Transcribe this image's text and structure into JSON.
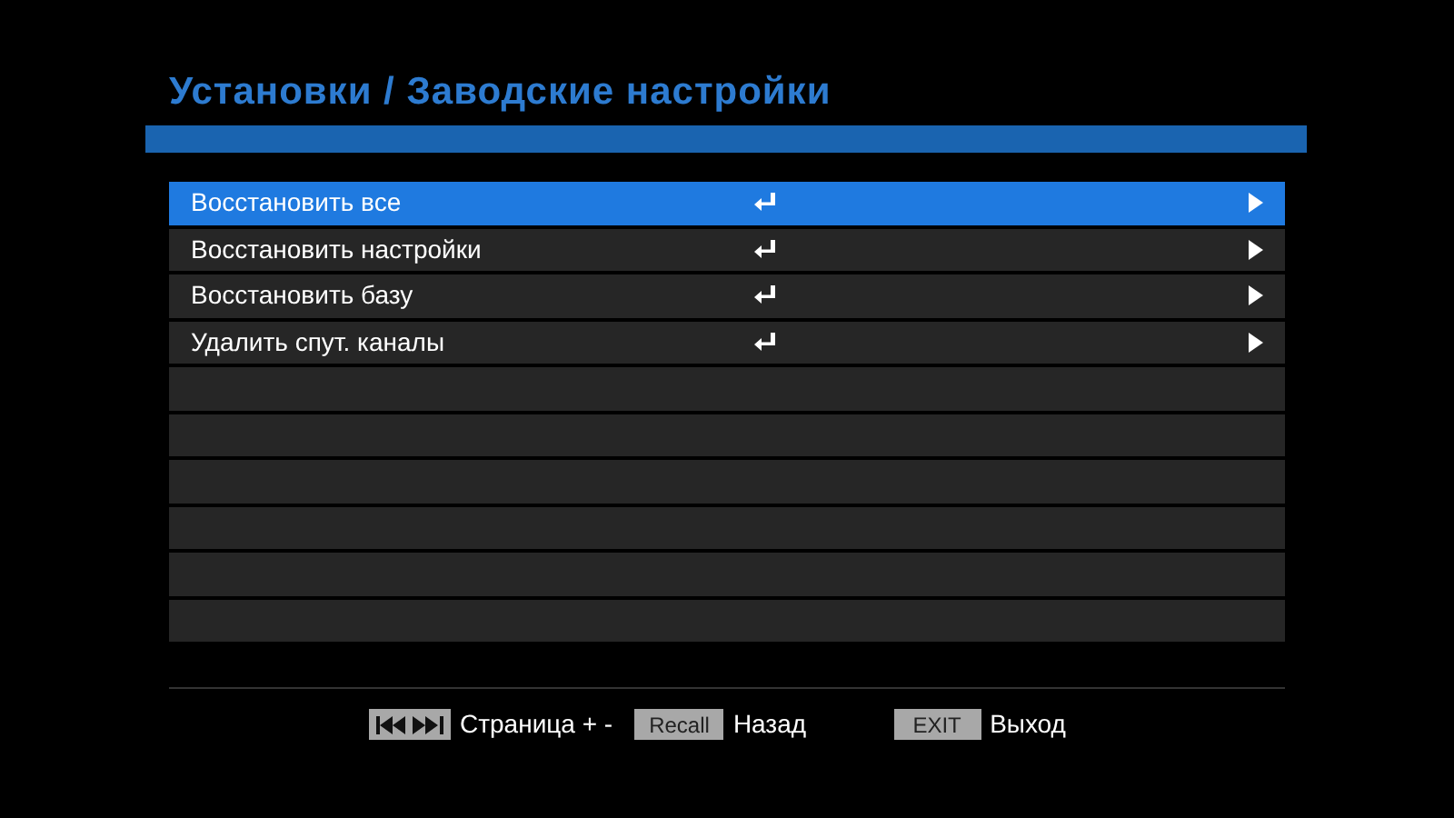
{
  "title": "Установки / Заводские настройки",
  "rows": [
    {
      "kind": "option",
      "label": "Восстановить все",
      "selected": true
    },
    {
      "kind": "option",
      "label": "Восстановить настройки",
      "selected": false
    },
    {
      "kind": "option",
      "label": "Восстановить базу",
      "selected": false
    },
    {
      "kind": "option",
      "label": "Удалить спут. каналы",
      "selected": false
    },
    {
      "kind": "empty"
    },
    {
      "kind": "empty"
    },
    {
      "kind": "empty"
    },
    {
      "kind": "empty"
    },
    {
      "kind": "empty"
    },
    {
      "kind": "empty"
    }
  ],
  "footer": [
    {
      "kind": "skip",
      "label": "Страница + -"
    },
    {
      "kind": "key",
      "key": "Recall",
      "label": "Назад"
    },
    {
      "kind": "key",
      "key": "EXIT",
      "label": "Выход"
    }
  ]
}
